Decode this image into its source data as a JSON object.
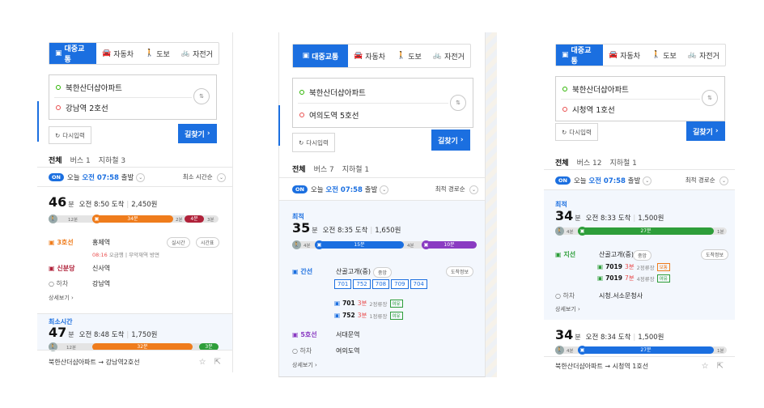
{
  "tabs": [
    {
      "label": "대중교통",
      "icon": "bus-icon"
    },
    {
      "label": "자동차",
      "icon": "car-icon"
    },
    {
      "label": "도보",
      "icon": "walk-icon"
    },
    {
      "label": "자전거",
      "icon": "bike-icon"
    }
  ],
  "common": {
    "reset": "다시입력",
    "search": "길찾기",
    "on": "ON",
    "today": "오늘",
    "more": "상세보기",
    "alight": "하차"
  },
  "panel1": {
    "start": "북한산더샵아파트",
    "end": "강남역 2호선",
    "filters": [
      "전체",
      "버스 1",
      "지하철 3"
    ],
    "depart_time": "오전 07:58",
    "depart_suffix": "출발",
    "sort": "최소 시간순",
    "route1": {
      "minutes": "46",
      "unit": "분",
      "arrive": "오전 8:50 도착",
      "fare": "2,450원",
      "seg_walk1": "12분",
      "seg_main": "34분",
      "seg_walk2": "2분",
      "seg_end": "4분",
      "seg_last": "3분",
      "line1": "3호선",
      "stop1": "홍제역",
      "pill_live": "실시간",
      "pill_table": "시간표",
      "sub_time": "08:16",
      "sub_text": "오금행 | 무악재역 방면",
      "line2": "신분당",
      "stop2": "신사역",
      "alight_stop": "강남역"
    },
    "route2": {
      "tag": "최소시간",
      "minutes": "47",
      "unit": "분",
      "arrive": "오전 8:48 도착",
      "fare": "1,750원",
      "seg_walk1": "12분",
      "seg_main": "32분",
      "seg_end": "3분"
    },
    "footer": "북한산더샵아파트 → 강남역2호선"
  },
  "panel2": {
    "start": "북한산더샵아파트",
    "end": "여의도역 5호선",
    "filters": [
      "전체",
      "버스 7",
      "지하철 1"
    ],
    "depart_time": "오전 07:58",
    "depart_suffix": "출발",
    "sort": "최적 경로순",
    "tag": "최적",
    "minutes": "35",
    "unit": "분",
    "arrive": "오전 8:35 도착",
    "fare": "1,650원",
    "seg_walk1": "4분",
    "seg_bus": "15분",
    "seg_walk2": "4분",
    "seg_sub": "10분",
    "bus_kind": "간선",
    "bus_stop": "산골고개(중)",
    "stop_no": "중앙",
    "stop_info": "도착정보",
    "buses": [
      "701",
      "752",
      "708",
      "709",
      "704"
    ],
    "arrivals": [
      {
        "no": "701",
        "mins": "3분",
        "pos": "2정류장",
        "crowd": "여유"
      },
      {
        "no": "752",
        "mins": "3분",
        "pos": "1정류장",
        "crowd": "여유"
      }
    ],
    "sub_kind": "5호선",
    "sub_stop": "서대문역",
    "alight_stop": "여의도역"
  },
  "panel3": {
    "start": "북한산더샵아파트",
    "end": "시청역 1호선",
    "filters": [
      "전체",
      "버스 12",
      "지하철 1"
    ],
    "depart_time": "오전 07:58",
    "depart_suffix": "출발",
    "sort": "최적 경로순",
    "route1": {
      "tag": "최적",
      "minutes": "34",
      "unit": "분",
      "arrive": "오전 8:33 도착",
      "fare": "1,500원",
      "seg_walk1": "4분",
      "seg_main": "27분",
      "seg_end": "1분",
      "bus_kind": "지선",
      "bus_stop": "산골고개(중)",
      "stop_no": "중앙",
      "stop_info": "도착정보",
      "arrivals": [
        {
          "no": "7019",
          "mins": "3분",
          "pos": "2정류장",
          "crowd": "보통"
        },
        {
          "no": "7019",
          "mins": "7분",
          "pos": "4정류장",
          "crowd": "여유"
        }
      ],
      "alight_stop": "시청.서소문청사"
    },
    "route2": {
      "minutes": "34",
      "unit": "분",
      "arrive": "오전 8:34 도착",
      "fare": "1,500원",
      "seg_walk1": "4분",
      "seg_main": "27분",
      "seg_end": "1분"
    },
    "footer": "북한산더샵아파트 → 시청역 1호선"
  },
  "colors": {
    "accent": "#1b6fe0",
    "line3": "#ef7c1c",
    "sinbundang": "#b0223a",
    "line5": "#8a3bc2",
    "branch_bus": "#2e9e3a"
  }
}
